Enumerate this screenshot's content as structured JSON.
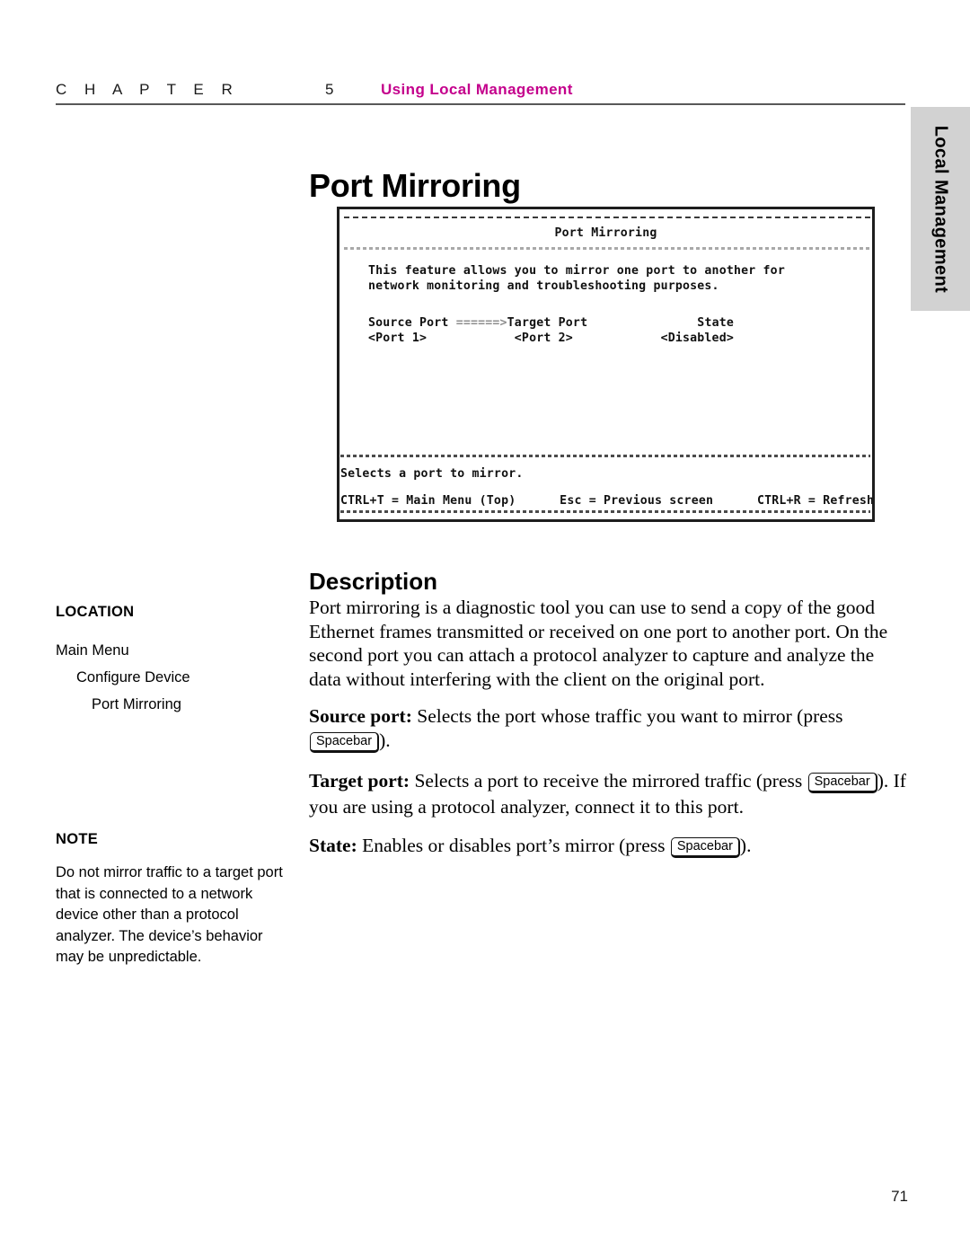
{
  "header": {
    "chapter_word": "C H A P T E R",
    "chapter_number": "5",
    "chapter_subject": "Using Local Management",
    "accent_color": "#C4008C",
    "rule_color": "#595959"
  },
  "side_tab": {
    "label": "Local Management",
    "background": "#d2d2d2"
  },
  "page": {
    "title": "Port Mirroring",
    "number": "71"
  },
  "terminal": {
    "title": "Port Mirroring",
    "body_lines": "This feature allows you to mirror one port to another for\nnetwork monitoring and troubleshooting purposes.",
    "column_headers_left": "Source Port ",
    "column_headers_arrow": "======>",
    "column_headers_rest": "Target Port               State",
    "column_values": "<Port 1>            <Port 2>            <Disabled>",
    "status_line": "Selects a port to mirror.",
    "key_help_line": "CTRL+T = Main Menu (Top)      Esc = Previous screen      CTRL+R = Refresh"
  },
  "description": {
    "heading": "Description",
    "paragraph_1": "Port mirroring is a diagnostic tool you can use to send a copy of the good Ethernet frames transmitted or received on one port to another port. On the second port you can attach a protocol analyzer to capture and analyze the data without interfering with the client on the original port.",
    "source_port_lead": "Source port:",
    "source_port_text_before": " Selects the port whose traffic you want to mirror (press ",
    "source_port_key": "Spacebar",
    "source_port_text_after": ").",
    "target_port_lead": "Target port:",
    "target_port_text_before": " Selects a port to receive the mirrored traffic (press ",
    "target_port_key": "Spacebar",
    "target_port_text_after": "). If you are using a protocol analyzer, connect it to this port.",
    "state_lead": "State:",
    "state_text_before": " Enables or disables port’s mirror (press ",
    "state_key": "Spacebar",
    "state_text_after": ")."
  },
  "margin": {
    "location_heading": "LOCATION",
    "location_items": [
      {
        "label": "Main Menu",
        "indent": 0
      },
      {
        "label": "Configure Device",
        "indent": 1
      },
      {
        "label": "Port Mirroring",
        "indent": 2
      }
    ],
    "note_heading": "NOTE",
    "note_text": "Do not mirror traffic to a target port that is connected to a network device other than a protocol analyzer. The device’s behavior may be unpredictable."
  }
}
